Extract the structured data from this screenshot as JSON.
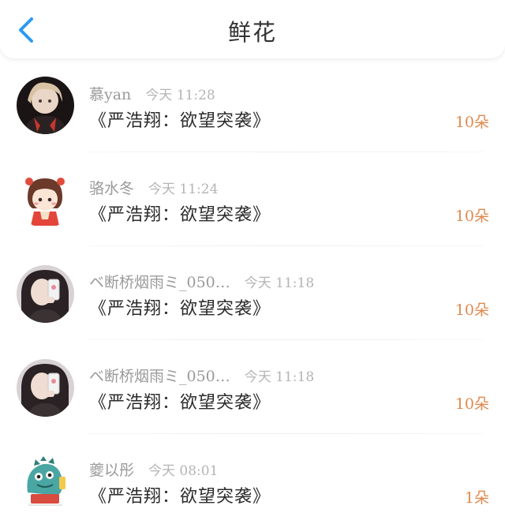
{
  "header": {
    "title": "鲜花",
    "back_icon": "chevron-left-icon",
    "accent": "#2c9af2"
  },
  "colors": {
    "count": "#e08a4f",
    "meta": "#9a9a9a"
  },
  "rows": [
    {
      "user": "慕yan",
      "time": "今天 11:28",
      "book": "《严浩翔：欲望突袭》",
      "count": "10朵",
      "avatar": "avatar-dark-portrait"
    },
    {
      "user": "骆水冬",
      "time": "今天 11:24",
      "book": "《严浩翔：欲望突袭》",
      "count": "10朵",
      "avatar": "avatar-cartoon-girl"
    },
    {
      "user": "ベ断桥烟雨ミ_050…",
      "time": "今天 11:18",
      "book": "《严浩翔：欲望突袭》",
      "count": "10朵",
      "avatar": "avatar-selfie-girl"
    },
    {
      "user": "ベ断桥烟雨ミ_050…",
      "time": "今天 11:18",
      "book": "《严浩翔：欲望突袭》",
      "count": "10朵",
      "avatar": "avatar-selfie-girl"
    },
    {
      "user": "夔以彤",
      "time": "今天 08:01",
      "book": "《严浩翔：欲望突袭》",
      "count": "1朵",
      "avatar": "avatar-cartoon-dinosaur"
    }
  ]
}
